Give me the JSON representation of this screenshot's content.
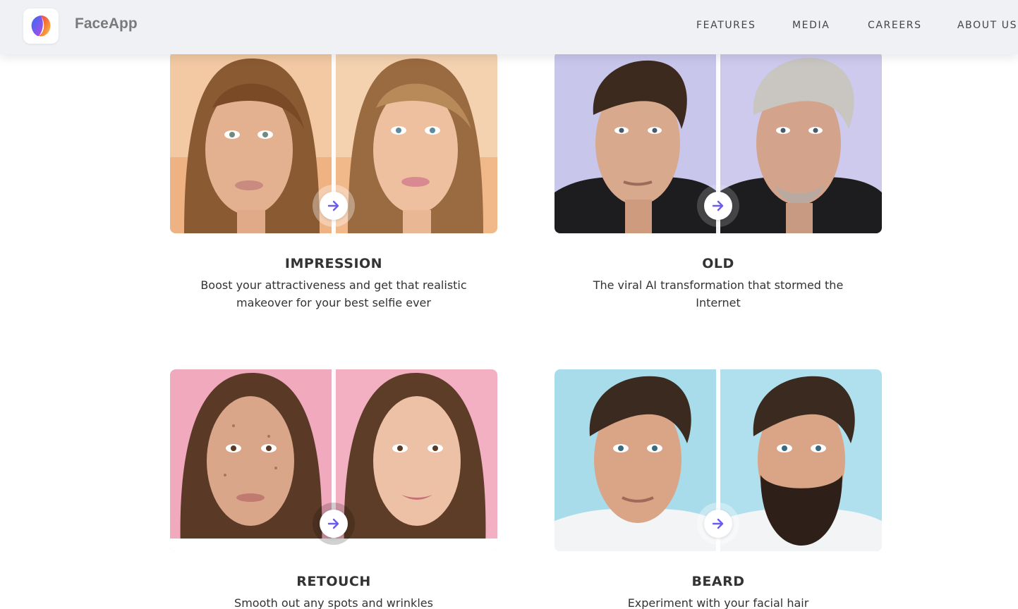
{
  "brand": {
    "name": "FaceApp",
    "logo_icon": "faceapp-logo-icon"
  },
  "nav": {
    "items": [
      {
        "label": "FEATURES"
      },
      {
        "label": "MEDIA"
      },
      {
        "label": "CAREERS"
      },
      {
        "label": "ABOUT US"
      }
    ]
  },
  "features": [
    {
      "title": "IMPRESSION",
      "description": "Boost your attractiveness and get that realistic makeover for your best selfie ever",
      "bg": "#f4c49a"
    },
    {
      "title": "OLD",
      "description": "The viral AI transformation that stormed the Internet",
      "bg": "#c9c6ec"
    },
    {
      "title": "RETOUCH",
      "description": "Smooth out any spots and wrinkles",
      "bg": "#f0a9bd"
    },
    {
      "title": "BEARD",
      "description": "Experiment with your facial hair",
      "bg": "#a9dceb"
    }
  ],
  "colors": {
    "accent": "#6b5bf0",
    "header_bg": "#f0f1f4"
  },
  "icons": {
    "arrow": "arrow-right-icon"
  }
}
